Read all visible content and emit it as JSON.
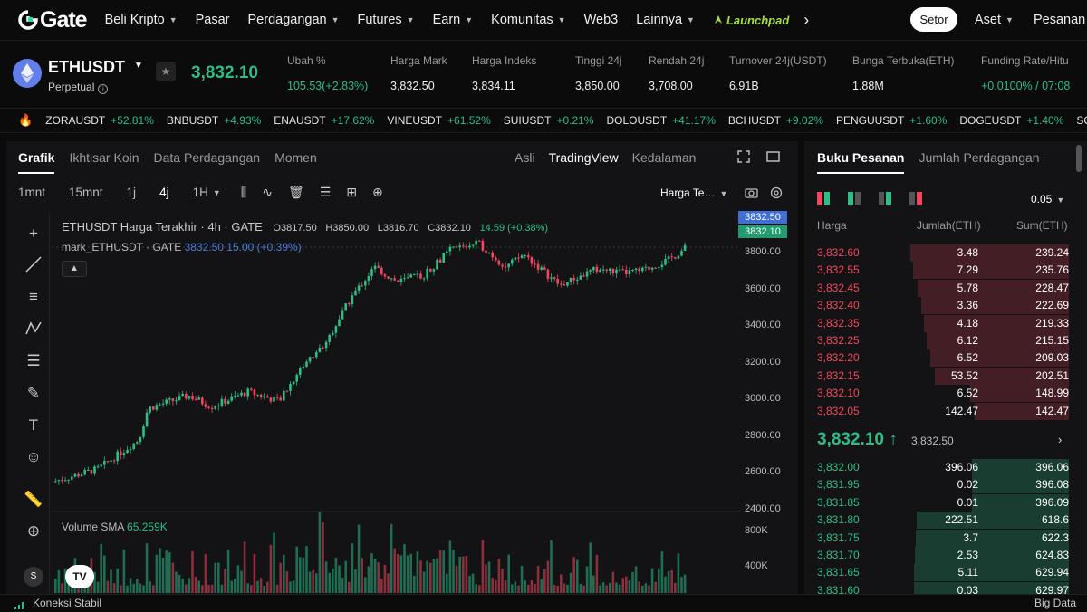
{
  "nav": {
    "logo_text": "Gate",
    "items": [
      {
        "label": "Beli Kripto",
        "caret": true
      },
      {
        "label": "Pasar",
        "caret": false
      },
      {
        "label": "Perdagangan",
        "caret": true
      },
      {
        "label": "Futures",
        "caret": true
      },
      {
        "label": "Earn",
        "caret": true
      },
      {
        "label": "Komunitas",
        "caret": true
      },
      {
        "label": "Web3",
        "caret": false
      },
      {
        "label": "Lainnya",
        "caret": true
      }
    ],
    "launchpad": "Launchpad",
    "more_arrow": "›",
    "setor": "Setor",
    "aset": "Aset",
    "pesanan": "Pesanan"
  },
  "ticker": {
    "symbol": "ETHUSDT",
    "type": "Perpetual",
    "price": "3,832.10",
    "stats": [
      {
        "label": "Ubah %",
        "value": "105.53(+2.83%)",
        "green": true
      },
      {
        "label": "Harga Mark",
        "value": "3,832.50",
        "green": false
      },
      {
        "label": "Harga Indeks",
        "value": "3,834.11",
        "green": false
      },
      {
        "label": "Tinggi 24j",
        "value": "3,850.00",
        "green": false
      },
      {
        "label": "Rendah 24j",
        "value": "3,708.00",
        "green": false
      },
      {
        "label": "Turnover 24j(USDT)",
        "value": "6.91B",
        "green": false
      },
      {
        "label": "Bunga Terbuka(ETH)",
        "value": "1.88M",
        "green": false
      },
      {
        "label": "Funding Rate/Hitu",
        "value": "+0.0100% / 07:08",
        "green": true
      }
    ]
  },
  "tape": [
    {
      "name": "ZORAUSDT",
      "change": "+52.81%"
    },
    {
      "name": "BNBUSDT",
      "change": "+4.93%"
    },
    {
      "name": "ENAUSDT",
      "change": "+17.62%"
    },
    {
      "name": "VINEUSDT",
      "change": "+61.52%"
    },
    {
      "name": "SUIUSDT",
      "change": "+0.21%"
    },
    {
      "name": "DOLOUSDT",
      "change": "+41.17%"
    },
    {
      "name": "BCHUSDT",
      "change": "+9.02%"
    },
    {
      "name": "PENGUUSDT",
      "change": "+1.60%"
    },
    {
      "name": "DOGEUSDT",
      "change": "+1.40%"
    },
    {
      "name": "SOLU",
      "change": ""
    }
  ],
  "chart_tabs": [
    "Grafik",
    "Ikhtisar Koin",
    "Data Perdagangan",
    "Momen"
  ],
  "view_tabs": [
    "Asli",
    "TradingView",
    "Kedalaman"
  ],
  "timeframes": [
    "1mnt",
    "15mnt",
    "1j",
    "4j",
    "1H"
  ],
  "harga_select": "Harga Te…",
  "legend": {
    "main": "ETHUSDT Harga Terakhir · 4h · GATE",
    "o": "O3817.50",
    "h": "H3850.00",
    "l": "L3816.70",
    "c": "C3832.10",
    "chg": "14.59 (+0.38%)",
    "mark": "mark_ETHUSDT · GATE",
    "mark_val": "3832.50  15.00 (+0.39%)",
    "volume": "Volume SMA",
    "volume_val": "65.259K"
  },
  "price_tags": {
    "mark": "3832.50",
    "last": "3832.10"
  },
  "yaxis": [
    "3800.00",
    "3600.00",
    "3400.00",
    "3200.00",
    "3000.00",
    "2800.00",
    "2600.00",
    "2400.00"
  ],
  "vol_axis": [
    "800K",
    "400K"
  ],
  "orderbook": {
    "tabs": [
      "Buku Pesanan",
      "Jumlah Perdagangan"
    ],
    "precision": "0.05",
    "headers": [
      "Harga",
      "Jumlah(ETH)",
      "Sum(ETH)"
    ],
    "asks": [
      {
        "p": "3,832.60",
        "a": "3.48",
        "s": "239.24"
      },
      {
        "p": "3,832.55",
        "a": "7.29",
        "s": "235.76"
      },
      {
        "p": "3,832.45",
        "a": "5.78",
        "s": "228.47"
      },
      {
        "p": "3,832.40",
        "a": "3.36",
        "s": "222.69"
      },
      {
        "p": "3,832.35",
        "a": "4.18",
        "s": "219.33"
      },
      {
        "p": "3,832.25",
        "a": "6.12",
        "s": "215.15"
      },
      {
        "p": "3,832.20",
        "a": "6.52",
        "s": "209.03"
      },
      {
        "p": "3,832.15",
        "a": "53.52",
        "s": "202.51"
      },
      {
        "p": "3,832.10",
        "a": "6.52",
        "s": "148.99"
      },
      {
        "p": "3,832.05",
        "a": "142.47",
        "s": "142.47"
      }
    ],
    "mid_price": "3,832.10 ↑",
    "mid_mark": "3,832.50",
    "bids": [
      {
        "p": "3,832.00",
        "a": "396.06",
        "s": "396.06"
      },
      {
        "p": "3,831.95",
        "a": "0.02",
        "s": "396.08"
      },
      {
        "p": "3,831.85",
        "a": "0.01",
        "s": "396.09"
      },
      {
        "p": "3,831.80",
        "a": "222.51",
        "s": "618.6"
      },
      {
        "p": "3,831.75",
        "a": "3.7",
        "s": "622.3"
      },
      {
        "p": "3,831.70",
        "a": "2.53",
        "s": "624.83"
      },
      {
        "p": "3,831.65",
        "a": "5.11",
        "s": "629.94"
      },
      {
        "p": "3,831.60",
        "a": "0.03",
        "s": "629.97"
      }
    ]
  },
  "status": {
    "connection": "Koneksi Stabil",
    "bigdata": "Big Data"
  },
  "colors": {
    "green": "#2dbd85",
    "red": "#f0475c",
    "bg": "#0b0b0c",
    "panel": "#131315"
  }
}
